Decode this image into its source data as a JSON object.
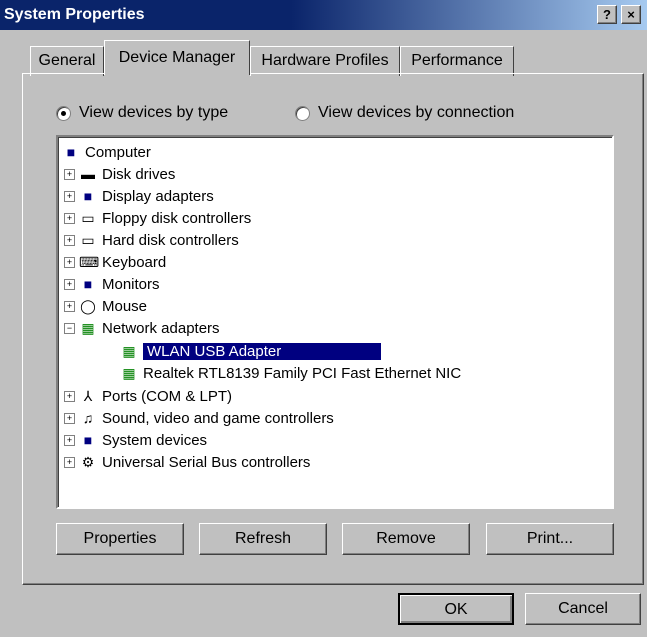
{
  "window": {
    "title": "System Properties",
    "help_btn": "?",
    "close_btn": "×"
  },
  "tabs": [
    "General",
    "Device Manager",
    "Hardware Profiles",
    "Performance"
  ],
  "view_options": [
    {
      "label": "View devices by type",
      "checked": true
    },
    {
      "label": "View devices by connection",
      "checked": false
    }
  ],
  "tree": {
    "root": "Computer",
    "items": [
      {
        "label": "Disk drives",
        "icon": "disk-drive-icon"
      },
      {
        "label": "Display adapters",
        "icon": "display-icon"
      },
      {
        "label": "Floppy disk controllers",
        "icon": "floppy-icon"
      },
      {
        "label": "Hard disk controllers",
        "icon": "hdd-controller-icon"
      },
      {
        "label": "Keyboard",
        "icon": "keyboard-icon"
      },
      {
        "label": "Monitors",
        "icon": "monitor-icon"
      },
      {
        "label": "Mouse",
        "icon": "mouse-icon"
      },
      {
        "label": "Network adapters",
        "icon": "network-adapter-icon",
        "expanded": true,
        "children": [
          {
            "label": "WLAN USB Adapter",
            "selected": true
          },
          {
            "label": "Realtek RTL8139 Family PCI Fast Ethernet NIC"
          }
        ]
      },
      {
        "label": "Ports (COM & LPT)",
        "icon": "ports-icon"
      },
      {
        "label": "Sound, video and game controllers",
        "icon": "sound-icon"
      },
      {
        "label": "System devices",
        "icon": "system-device-icon"
      },
      {
        "label": "Universal Serial Bus controllers",
        "icon": "usb-icon"
      }
    ]
  },
  "actions": {
    "properties": "Properties",
    "refresh": "Refresh",
    "remove": "Remove",
    "print": "Print..."
  },
  "dialog": {
    "ok": "OK",
    "cancel": "Cancel"
  }
}
